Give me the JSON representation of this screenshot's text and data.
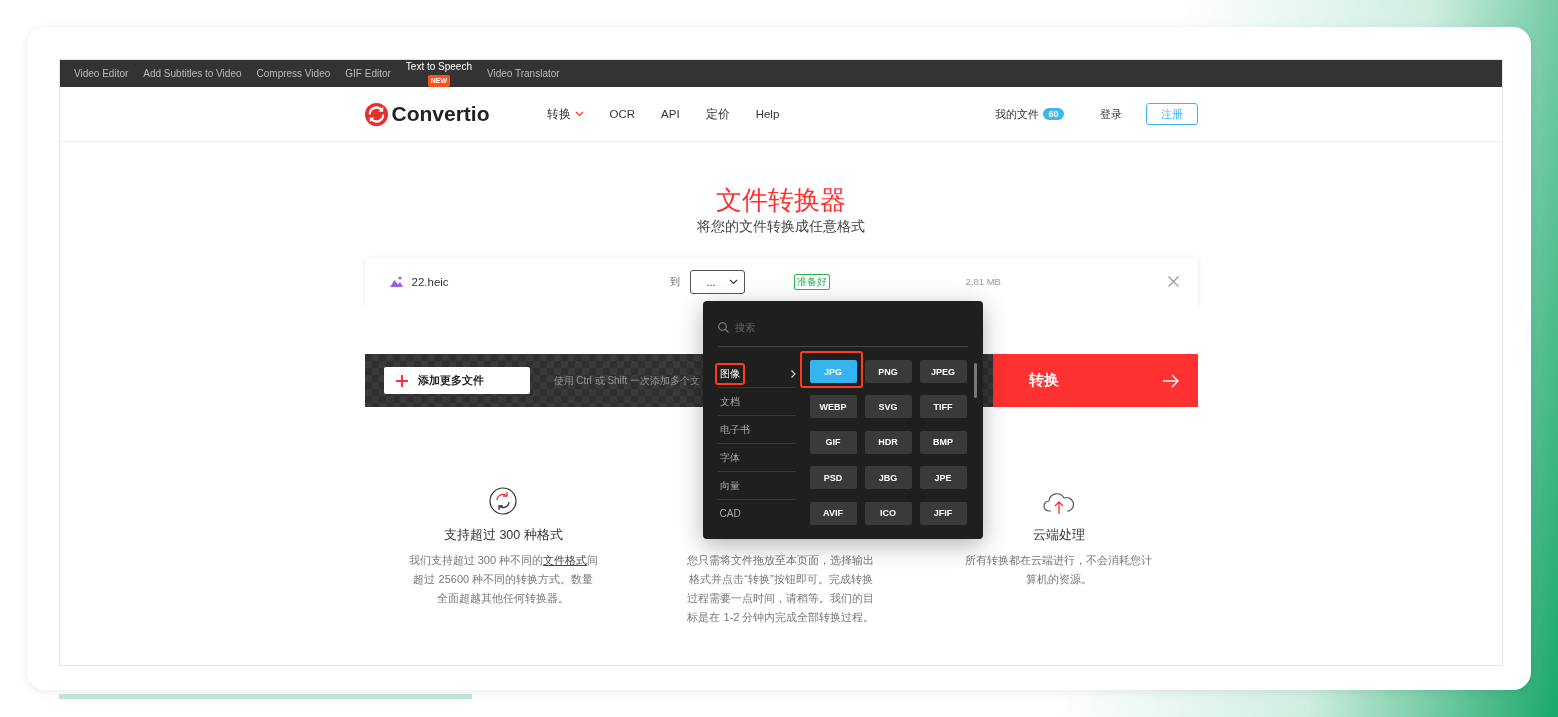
{
  "top_bar": {
    "links": [
      {
        "label": "Video Editor",
        "featured": false
      },
      {
        "label": "Add Subtitles to Video",
        "featured": false
      },
      {
        "label": "Compress Video",
        "featured": false
      },
      {
        "label": "GIF Editor",
        "featured": false
      },
      {
        "label": "Text to Speech",
        "badge": "NEW",
        "featured": true
      },
      {
        "label": "Video Translator",
        "featured": false
      }
    ]
  },
  "header": {
    "logo": "Convertio",
    "nav": [
      {
        "label": "转换",
        "dropdown": true
      },
      {
        "label": "OCR",
        "dropdown": false
      },
      {
        "label": "API",
        "dropdown": false
      },
      {
        "label": "定价",
        "dropdown": false
      },
      {
        "label": "Help",
        "dropdown": false
      }
    ],
    "my_files": "我的文件",
    "my_files_count": "60",
    "login": "登录",
    "signup": "注册"
  },
  "hero": {
    "title": "文件转换器",
    "subtitle": "将您的文件转换成任意格式"
  },
  "file_row": {
    "name": "22.heic",
    "to_label": "到",
    "target": "...",
    "status": "准备好",
    "size": "2.81 MB"
  },
  "action_bar": {
    "add_button": "添加更多文件",
    "hint": "使用 Ctrl 或 Shift 一次添加多个文",
    "convert": "转换"
  },
  "format_menu": {
    "search_placeholder": "搜索",
    "categories": [
      {
        "label": "图像",
        "selected": true,
        "highlighted": true
      },
      {
        "label": "文档",
        "selected": false,
        "highlighted": false
      },
      {
        "label": "电子书",
        "selected": false,
        "highlighted": false
      },
      {
        "label": "字体",
        "selected": false,
        "highlighted": false
      },
      {
        "label": "向量",
        "selected": false,
        "highlighted": false
      },
      {
        "label": "CAD",
        "selected": false,
        "highlighted": false
      }
    ],
    "formats": [
      {
        "label": "JPG",
        "selected": true,
        "highlighted": true
      },
      {
        "label": "PNG",
        "selected": false,
        "highlighted": false
      },
      {
        "label": "JPEG",
        "selected": false,
        "highlighted": false
      },
      {
        "label": "WEBP",
        "selected": false,
        "highlighted": false
      },
      {
        "label": "SVG",
        "selected": false,
        "highlighted": false
      },
      {
        "label": "TIFF",
        "selected": false,
        "highlighted": false
      },
      {
        "label": "GIF",
        "selected": false,
        "highlighted": false
      },
      {
        "label": "HDR",
        "selected": false,
        "highlighted": false
      },
      {
        "label": "BMP",
        "selected": false,
        "highlighted": false
      },
      {
        "label": "PSD",
        "selected": false,
        "highlighted": false
      },
      {
        "label": "JBG",
        "selected": false,
        "highlighted": false
      },
      {
        "label": "JPE",
        "selected": false,
        "highlighted": false
      },
      {
        "label": "AVIF",
        "selected": false,
        "highlighted": false
      },
      {
        "label": "ICO",
        "selected": false,
        "highlighted": false
      },
      {
        "label": "JFIF",
        "selected": false,
        "highlighted": false
      }
    ]
  },
  "features": [
    {
      "title": "支持超过 300 种格式",
      "text_before": "我们支持超过 300 种不同的",
      "link": "文件格式",
      "text_after": "间超过 25600 种不同的转换方式。数量全面超越其他任何转换器。"
    },
    {
      "text_before": "您只需将文件拖放至本页面，选择输出格式并点击“转换”按钮即可。完成转换过程需要一点时间，请稍等。我们的目标是在 1-2 分钟内完成全部转换过程。"
    },
    {
      "title": "云端处理",
      "text_before": "所有转换都在云端进行，不会消耗您计算机的资源。"
    }
  ]
}
